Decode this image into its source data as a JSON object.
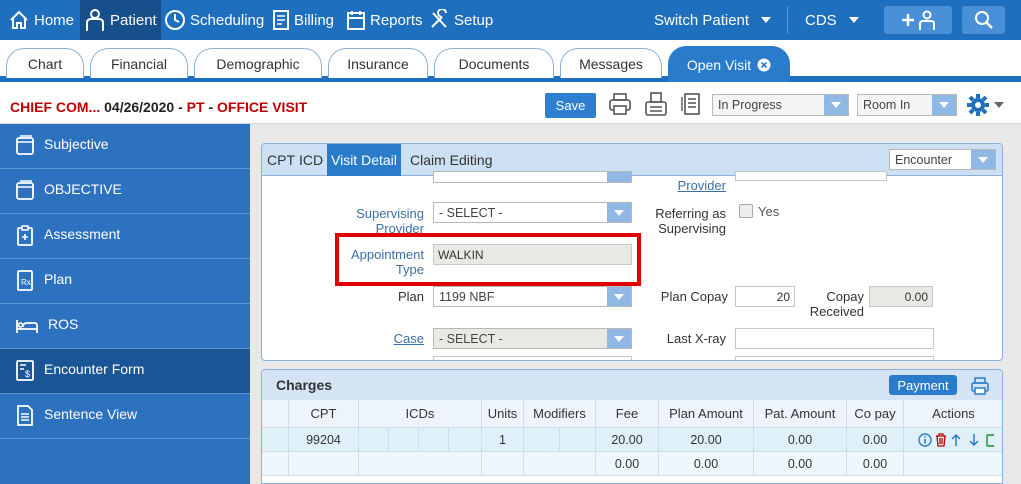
{
  "topnav": {
    "home": "Home",
    "patient": "Patient",
    "scheduling": "Scheduling",
    "billing": "Billing",
    "reports": "Reports",
    "setup": "Setup",
    "switch_patient": "Switch Patient",
    "cds": "CDS"
  },
  "tabs": [
    "Chart",
    "Financial",
    "Demographic",
    "Insurance",
    "Documents",
    "Messages",
    "Open Visit"
  ],
  "visit": {
    "chief": "CHIEF COM...",
    "date": "04/26/2020",
    "dash1": "-",
    "pt": "PT",
    "dash2": "-",
    "type": "OFFICE VISIT",
    "save": "Save",
    "status": "In Progress",
    "room": "Room In"
  },
  "sidebar": [
    "Subjective",
    "OBJECTIVE",
    "Assessment",
    "Plan",
    "ROS",
    "Encounter Form",
    "Sentence View"
  ],
  "panel": {
    "tabs": [
      "CPT",
      "ICD",
      "Visit Detail",
      "Claim Editing"
    ],
    "encounter_select": "Encounter",
    "provider_label": "Provider",
    "supervising_label1": "Supervising",
    "supervising_label2": "Provider",
    "supervising_value": "- SELECT -",
    "referring_label1": "Referring as",
    "referring_label2": "Supervising",
    "yes": "Yes",
    "appt_label1": "Appointment",
    "appt_label2": "Type",
    "appt_value": "WALKIN",
    "plan_label": "Plan",
    "plan_value": "1199 NBF",
    "plan_copay_label": "Plan Copay",
    "plan_copay_value": "20",
    "copay_received_label1": "Copay",
    "copay_received_label2": "Received",
    "copay_received_value": "0.00",
    "case_label": "Case",
    "case_value": "- SELECT -",
    "last_xray_label": "Last X-ray"
  },
  "charges": {
    "title": "Charges",
    "payment": "Payment",
    "headers": [
      "CPT",
      "ICDs",
      "Units",
      "Modifiers",
      "Fee",
      "Plan Amount",
      "Pat. Amount",
      "Co pay",
      "Actions"
    ],
    "row1": {
      "cpt": "99204",
      "units": "1",
      "fee": "20.00",
      "plan": "20.00",
      "pat": "0.00",
      "copay": "0.00"
    },
    "row2": {
      "fee": "0.00",
      "plan": "0.00",
      "pat": "0.00",
      "copay": "0.00"
    }
  },
  "colors": {
    "primary": "#1f6fbf",
    "highlight": "#e10000",
    "accent_red": "#c00000"
  }
}
